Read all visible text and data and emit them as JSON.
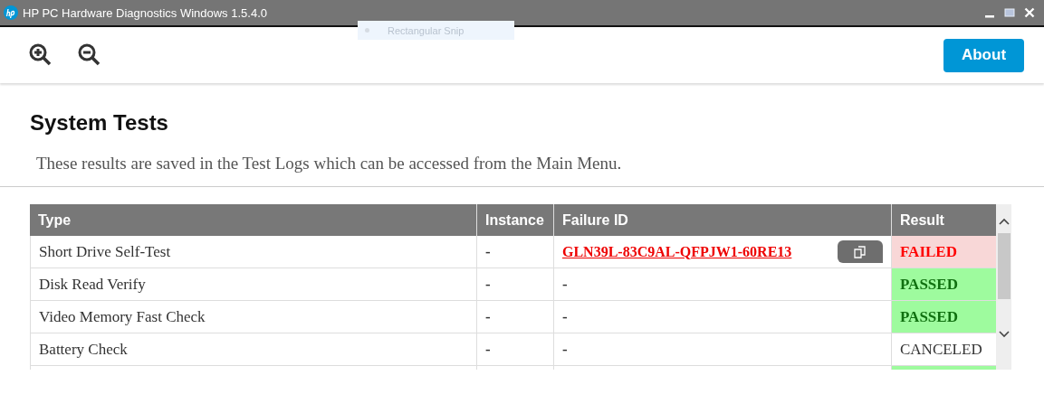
{
  "window": {
    "title": "HP PC Hardware Diagnostics Windows 1.5.4.0"
  },
  "overlay_tooltip": {
    "text": "Rectangular Snip"
  },
  "toolbar": {
    "about_button": "About"
  },
  "page": {
    "title": "System Tests",
    "description": "These results are saved in the Test Logs which can be accessed from the Main Menu."
  },
  "table": {
    "columns": [
      "Type",
      "Instance",
      "Failure ID",
      "Result"
    ],
    "rows": [
      {
        "type": "Short Drive Self-Test",
        "instance": "-",
        "failure_id": {
          "text": "GLN39L-83C9AL-QFPJW1-60RE13",
          "kind": "link"
        },
        "result": {
          "text": "FAILED",
          "kind": "failed"
        }
      },
      {
        "type": "Disk Read Verify",
        "instance": "-",
        "failure_id": {
          "text": "-",
          "kind": "plain"
        },
        "result": {
          "text": "PASSED",
          "kind": "passed"
        }
      },
      {
        "type": "Video Memory Fast Check",
        "instance": "-",
        "failure_id": {
          "text": "-",
          "kind": "plain"
        },
        "result": {
          "text": "PASSED",
          "kind": "passed"
        }
      },
      {
        "type": "Battery Check",
        "instance": "-",
        "failure_id": {
          "text": "-",
          "kind": "plain"
        },
        "result": {
          "text": "CANCELED",
          "kind": "canceled"
        }
      },
      {
        "result": {
          "kind": "passed"
        }
      }
    ]
  }
}
